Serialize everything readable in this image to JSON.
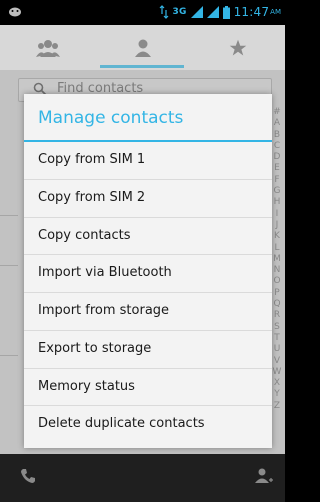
{
  "status_bar": {
    "network": "3G",
    "time": "11:47",
    "ampm": "AM"
  },
  "background": {
    "tabs": [
      "people-icon",
      "person-icon",
      "star-icon"
    ],
    "search_placeholder": "Find contacts",
    "index_letters": [
      "#",
      "A",
      "B",
      "C",
      "D",
      "E",
      "F",
      "G",
      "H",
      "I",
      "J",
      "K",
      "L",
      "M",
      "N",
      "O",
      "P",
      "Q",
      "R",
      "S",
      "T",
      "U",
      "V",
      "W",
      "X",
      "Y",
      "Z"
    ]
  },
  "dialog": {
    "title": "Manage contacts",
    "items": [
      "Copy from SIM 1",
      "Copy from SIM 2",
      "Copy contacts",
      "Import via Bluetooth",
      "Import from storage",
      "Export to storage",
      "Memory status",
      "Delete duplicate contacts"
    ]
  },
  "colors": {
    "accent": "#33b5e5",
    "dim_background": "#c2c2c2"
  }
}
